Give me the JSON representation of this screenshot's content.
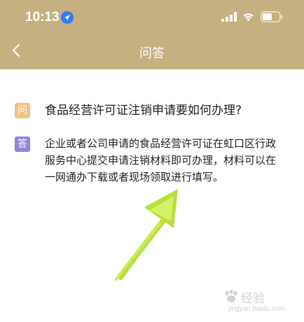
{
  "status_bar": {
    "time": "10:13"
  },
  "header": {
    "title": "问答"
  },
  "qa": {
    "question_badge": "问",
    "question": "食品经营许可证注销申请要如何办理?",
    "answer_badge": "答",
    "answer": "企业或者公司申请的食品经营许可证在虹口区行政服务中心提交申请注销材料即可办理，材料可以在一网通办下载或者现场领取进行填写。"
  },
  "watermark": {
    "text": "经验",
    "url": "jingyan.baidu.com"
  },
  "colors": {
    "header_bg": "#c4b081",
    "question_badge": "#f1c27e",
    "answer_badge": "#8e86d8",
    "arrow": "#b7e03a"
  }
}
